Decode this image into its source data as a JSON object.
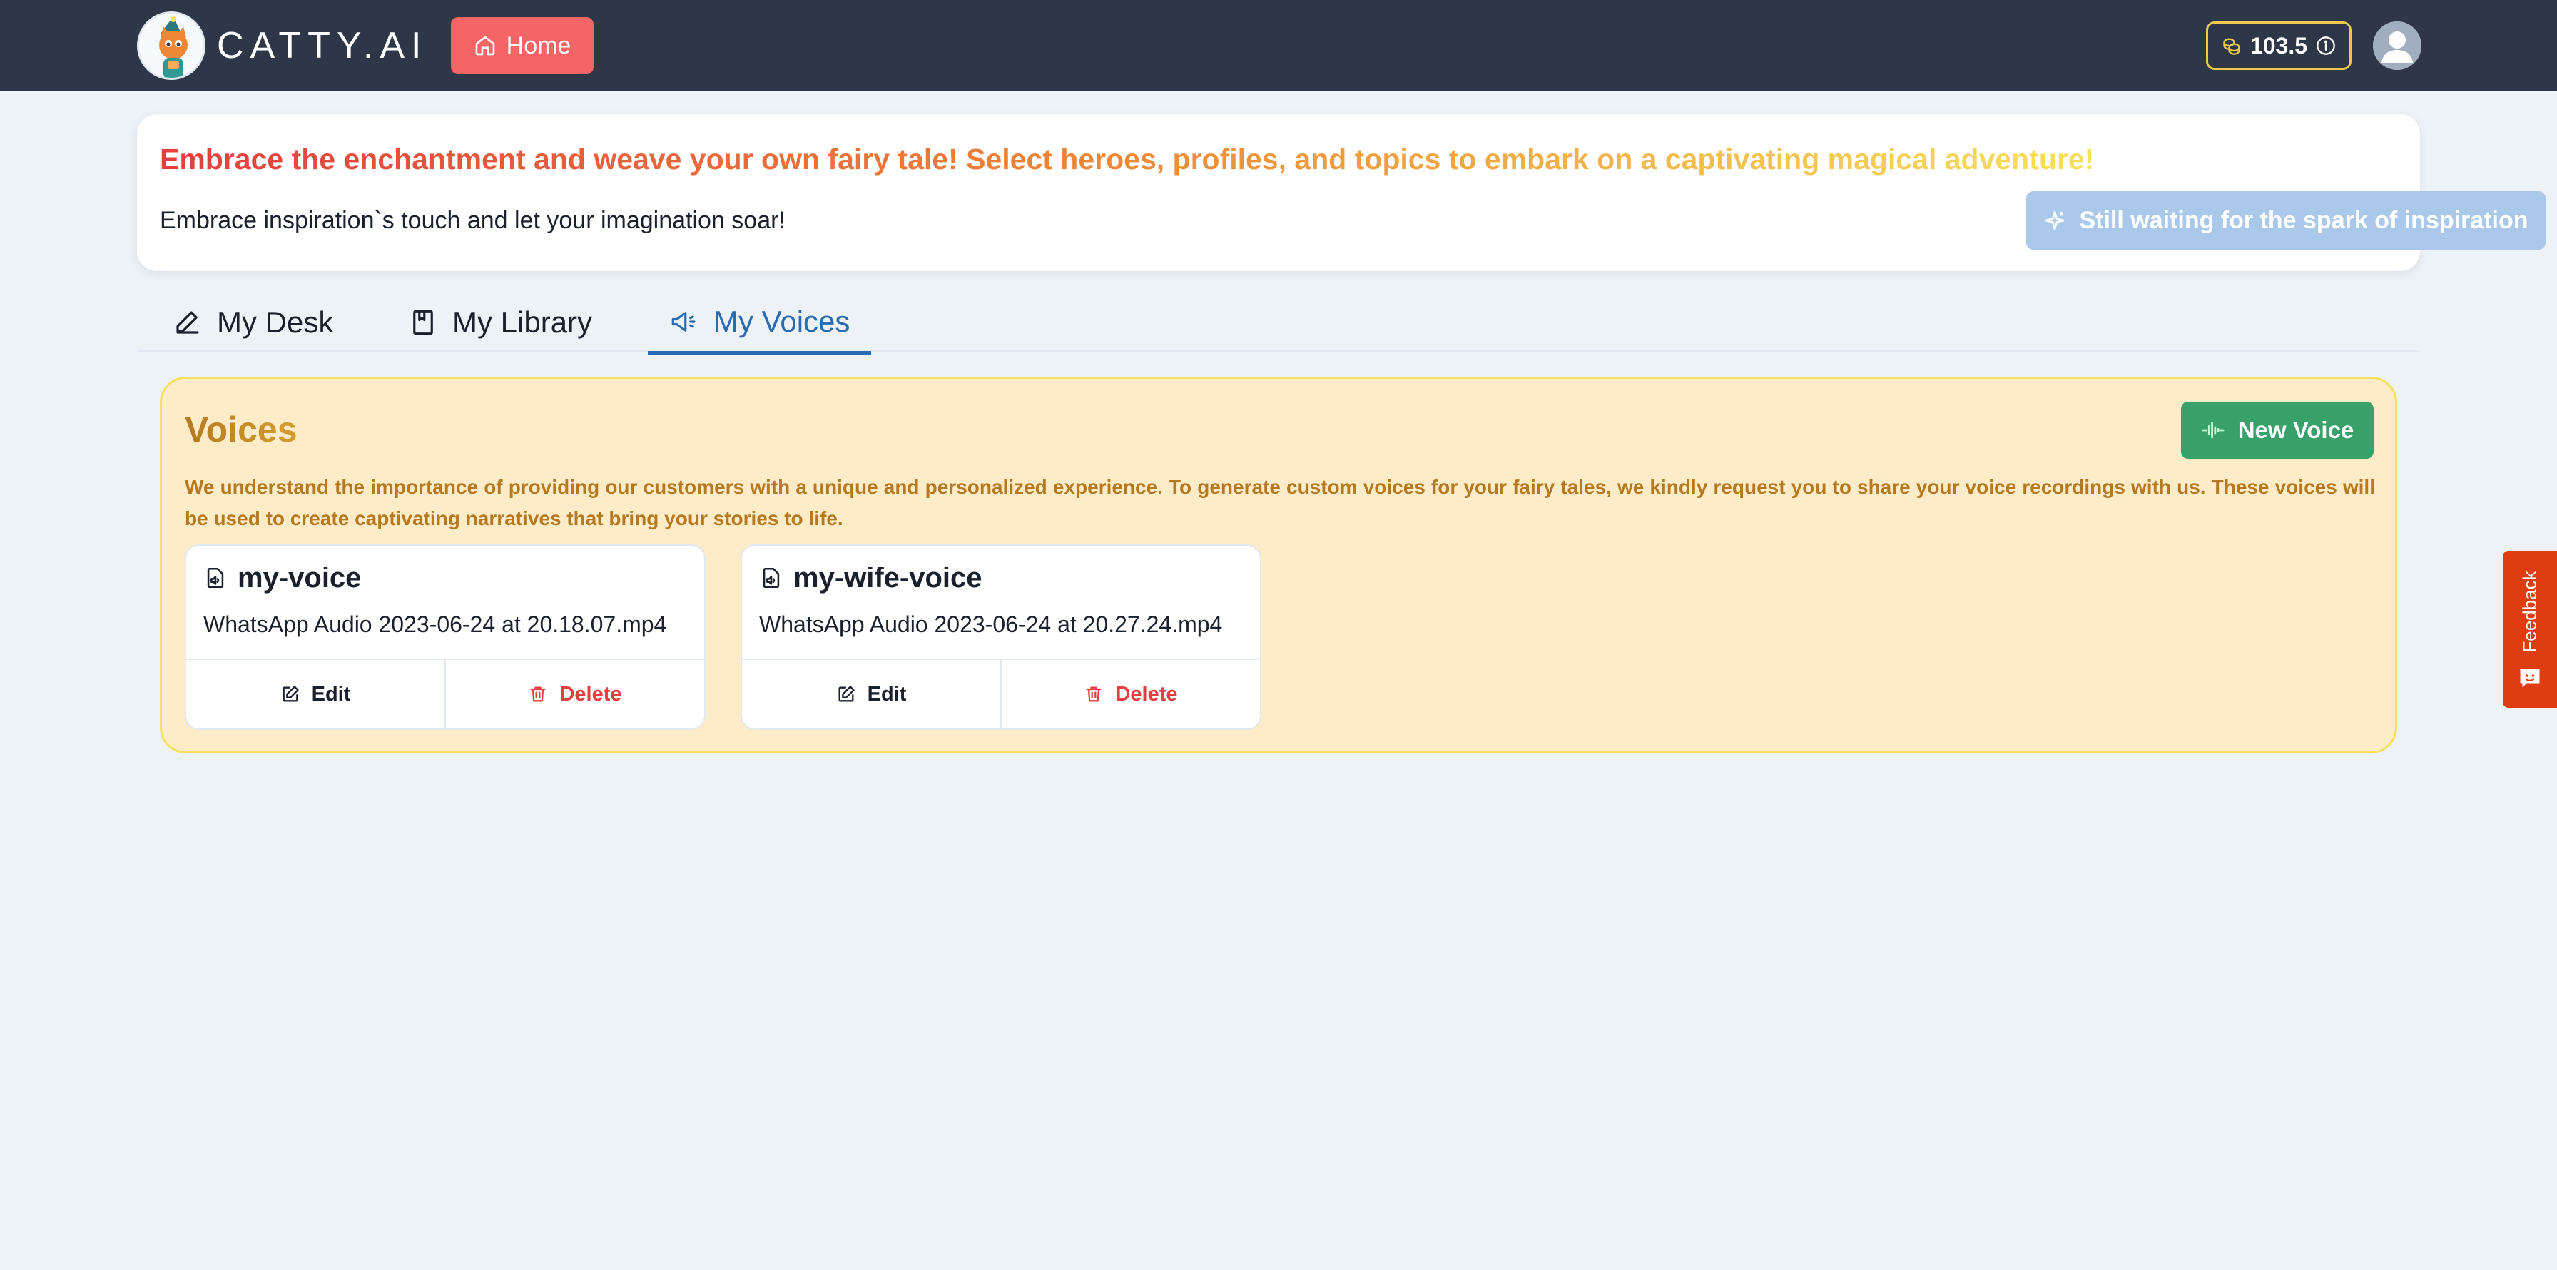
{
  "header": {
    "brand": "CATTY.AI",
    "home_label": "Home",
    "credits": "103.5"
  },
  "banner": {
    "title": "Embrace the enchantment and weave your own fairy tale! Select heroes, profiles, and topics to embark on a captivating magical adventure!",
    "subtitle": "Embrace inspiration`s touch and let your imagination soar!",
    "inspire_button": "Still waiting for the spark of inspiration"
  },
  "tabs": [
    {
      "label": "My Desk",
      "icon": "pencil-icon",
      "active": false
    },
    {
      "label": "My Library",
      "icon": "book-icon",
      "active": false
    },
    {
      "label": "My Voices",
      "icon": "megaphone-icon",
      "active": true
    }
  ],
  "voices": {
    "title": "Voices",
    "new_voice_label": "New Voice",
    "description": "We understand the importance of providing our customers with a unique and personalized experience. To generate custom voices for your fairy tales, we kindly request you to share your voice recordings with us. These voices will be used to create captivating narratives that bring your stories to life.",
    "cards": [
      {
        "name": "my-voice",
        "file": "WhatsApp Audio 2023-06-24 at 20.18.07.mp4",
        "edit_label": "Edit",
        "delete_label": "Delete"
      },
      {
        "name": "my-wife-voice",
        "file": "WhatsApp Audio 2023-06-24 at 20.27.24.mp4",
        "edit_label": "Edit",
        "delete_label": "Delete"
      }
    ]
  },
  "feedback": {
    "label": "Feedback"
  },
  "colors": {
    "navbar": "#2d3748",
    "home_button": "#f56565",
    "credits_border": "#ecc94b",
    "active_tab": "#2b6cb0",
    "new_voice_button": "#38a169",
    "delete": "#e53e3e",
    "feedback": "#dd3d10",
    "panel_bg": "#feebc8"
  }
}
